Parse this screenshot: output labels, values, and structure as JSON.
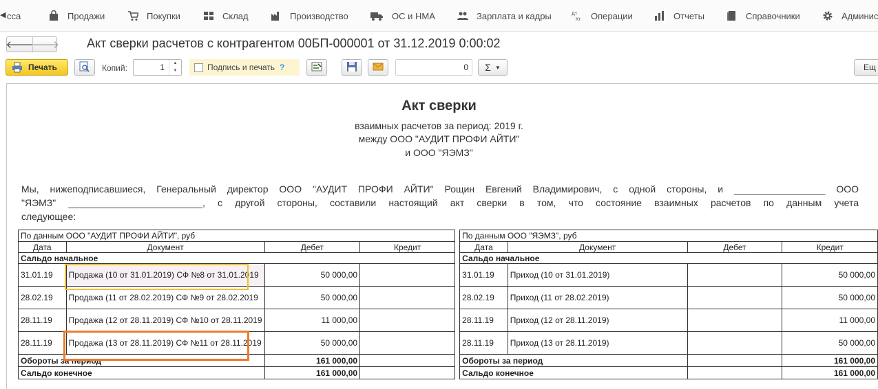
{
  "menu": {
    "items": [
      {
        "label": "сса",
        "icon": "cash-icon"
      },
      {
        "label": "Продажи",
        "icon": "bag-icon"
      },
      {
        "label": "Покупки",
        "icon": "cart-icon"
      },
      {
        "label": "Склад",
        "icon": "warehouse-icon"
      },
      {
        "label": "Производство",
        "icon": "factory-icon"
      },
      {
        "label": "ОС и НМА",
        "icon": "truck-icon"
      },
      {
        "label": "Зарплата и кадры",
        "icon": "people-icon"
      },
      {
        "label": "Операции",
        "icon": "debit-credit-icon"
      },
      {
        "label": "Отчеты",
        "icon": "bar-chart-icon"
      },
      {
        "label": "Справочники",
        "icon": "books-icon"
      },
      {
        "label": "Админис",
        "icon": "gear-icon"
      }
    ]
  },
  "window": {
    "title": "Акт сверки расчетов с контрагентом 00БП-000001 от 31.12.2019 0:00:02"
  },
  "toolbar": {
    "print_label": "Печать",
    "copies_label": "Копий:",
    "copies_value": "1",
    "sign_label": "Подпись и печать",
    "help_label": "?",
    "sum_value": "0",
    "sigma_label": "Σ",
    "more_label": "Ещ"
  },
  "report": {
    "title": "Акт сверки",
    "subtitle_period": "взаимных расчетов за период: 2019 г.",
    "subtitle_between": "между ООО \"АУДИТ ПРОФИ АЙТИ\"",
    "subtitle_and": "и ООО \"ЯЭМЗ\"",
    "paragraph_line1": "Мы, нижеподписавшиеся, Генеральный директор ООО \"АУДИТ ПРОФИ АЙТИ\" Рощин Евгений Владимирович, с одной стороны, и _________________ ООО",
    "paragraph_line2": "\"ЯЭМЗ\" _________________________, с другой стороны, составили настоящий акт сверки в том, что состояние взаимных расчетов по данным учета",
    "paragraph_line3": "следующее:"
  },
  "table": {
    "left_party": "По данным ООО \"АУДИТ ПРОФИ АЙТИ\", руб",
    "right_party": "По данным ООО \"ЯЭМЗ\", руб",
    "headers": {
      "date": "Дата",
      "document": "Документ",
      "debit": "Дебет",
      "credit": "Кредит"
    },
    "opening_label": "Сальдо начальное",
    "rows": [
      {
        "l_date": "31.01.19",
        "l_doc": "Продажа (10 от 31.01.2019) СФ №8 от 31.01.2019",
        "l_debit": "50 000,00",
        "l_credit": "",
        "r_date": "31.01.19",
        "r_doc": "Приход (10 от 31.01.2019)",
        "r_debit": "",
        "r_credit": "50 000,00"
      },
      {
        "l_date": "28.02.19",
        "l_doc": "Продажа (11 от 28.02.2019) СФ №9 от 28.02.2019",
        "l_debit": "50 000,00",
        "l_credit": "",
        "r_date": "28.02.19",
        "r_doc": "Приход (11 от 28.02.2019)",
        "r_debit": "",
        "r_credit": "50 000,00"
      },
      {
        "l_date": "28.11.19",
        "l_doc": "Продажа (12 от 28.11.2019) СФ №10 от 28.11.2019",
        "l_debit": "11 000,00",
        "l_credit": "",
        "r_date": "28.11.19",
        "r_doc": "Приход (12 от 28.11.2019)",
        "r_debit": "",
        "r_credit": "11 000,00"
      },
      {
        "l_date": "28.11.19",
        "l_doc": "Продажа (13 от 28.11.2019) СФ №11 от 28.11.2019",
        "l_debit": "50 000,00",
        "l_credit": "",
        "r_date": "28.11.19",
        "r_doc": "Приход (13 от 28.11.2019)",
        "r_debit": "",
        "r_credit": "50 000,00"
      }
    ],
    "turnover_label": "Обороты за период",
    "turnover_left_debit": "161 000,00",
    "turnover_right_credit": "161 000,00",
    "closing_label": "Сальдо конечное",
    "closing_left_debit": "161 000,00",
    "closing_right_credit": "161 000,00"
  },
  "colors": {
    "highlight_yellow": "#f0c030",
    "highlight_orange": "#ef7a2a",
    "print_button": "#f4c520"
  }
}
